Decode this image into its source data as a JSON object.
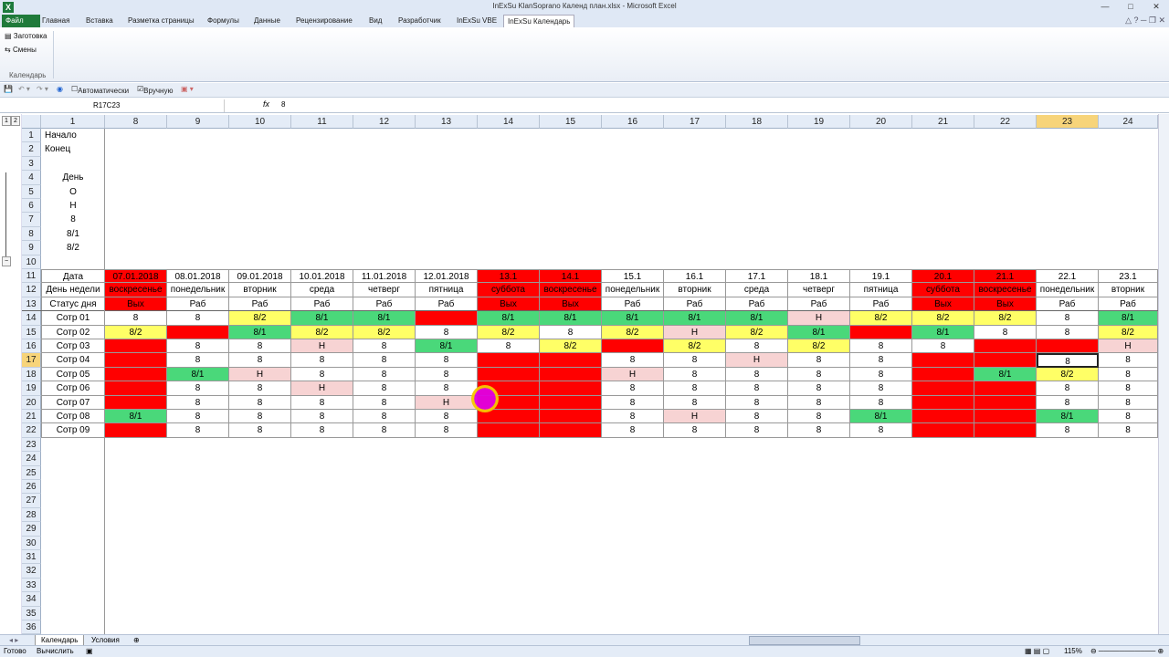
{
  "title": "InExSu KlanSoprano Календ план.xlsx - Microsoft Excel",
  "tabs": [
    "Файл",
    "Главная",
    "Вставка",
    "Разметка страницы",
    "Формулы",
    "Данные",
    "Рецензирование",
    "Вид",
    "Разработчик",
    "InExSu VBE",
    "InExSu Календарь"
  ],
  "ribbon": {
    "btn1": "Заготовка",
    "btn2": "Смены",
    "group": "Календарь"
  },
  "qat": {
    "auto": "Автоматически",
    "manual": "Вручную"
  },
  "formula": {
    "namebox": "R17C23",
    "fx": "fx",
    "value": "8"
  },
  "columns": [
    "1",
    "8",
    "9",
    "10",
    "11",
    "12",
    "13",
    "14",
    "15",
    "16",
    "17",
    "18",
    "19",
    "20",
    "21",
    "22",
    "23",
    "24"
  ],
  "rows": [
    "1",
    "2",
    "3",
    "4",
    "5",
    "6",
    "7",
    "8",
    "9",
    "10",
    "11",
    "12",
    "13",
    "14",
    "15",
    "16",
    "17",
    "18",
    "19",
    "20",
    "21",
    "22",
    "23",
    "24",
    "25",
    "26",
    "27",
    "28",
    "29",
    "30",
    "31",
    "32",
    "33",
    "34",
    "35",
    "36"
  ],
  "top_labels": {
    "r1": "Начало",
    "r2": "Конец",
    "r4": "День",
    "r5": "О",
    "r6": "Н",
    "r7": "8",
    "r8": "8/1",
    "r9": "8/2"
  },
  "header_rows": {
    "date": [
      "Дата",
      "07.01.2018",
      "08.01.2018",
      "09.01.2018",
      "10.01.2018",
      "11.01.2018",
      "12.01.2018",
      "13.1",
      "14.1",
      "15.1",
      "16.1",
      "17.1",
      "18.1",
      "19.1",
      "20.1",
      "21.1",
      "22.1",
      "23.1"
    ],
    "weekday": [
      "День недели",
      "воскресенье",
      "понедельник",
      "вторник",
      "среда",
      "четверг",
      "пятница",
      "суббота",
      "воскресенье",
      "понедельник",
      "вторник",
      "среда",
      "четверг",
      "пятница",
      "суббота",
      "воскресенье",
      "понедельник",
      "вторник"
    ],
    "status": [
      "Статус дня",
      "Вых",
      "Раб",
      "Раб",
      "Раб",
      "Раб",
      "Раб",
      "Вых",
      "Вых",
      "Раб",
      "Раб",
      "Раб",
      "Раб",
      "Раб",
      "Вых",
      "Вых",
      "Раб",
      "Раб"
    ]
  },
  "staff": [
    {
      "name": "Сотр 01",
      "cells": [
        "8",
        "8",
        "8/2",
        "8/1",
        "8/1",
        "",
        "8/1",
        "8/1",
        "8/1",
        "8/1",
        "8/1",
        "Н",
        "8/2",
        "8/2",
        "8/2",
        "8",
        "8/1"
      ],
      "colors": [
        "",
        "",
        "y",
        "g",
        "g",
        "r",
        "g",
        "g",
        "g",
        "g",
        "g",
        "p",
        "y",
        "y",
        "y",
        "",
        "g"
      ]
    },
    {
      "name": "Сотр 02",
      "cells": [
        "8/2",
        "",
        "8/1",
        "8/2",
        "8/2",
        "8",
        "8/2",
        "8",
        "8/2",
        "Н",
        "8/2",
        "8/1",
        "",
        "8/1",
        "8",
        "8",
        "8/2"
      ],
      "colors": [
        "y",
        "r",
        "g",
        "y",
        "y",
        "",
        "y",
        "",
        "y",
        "p",
        "y",
        "g",
        "r",
        "g",
        "",
        "",
        "y"
      ]
    },
    {
      "name": "Сотр 03",
      "cells": [
        "",
        "8",
        "8",
        "Н",
        "8",
        "8/1",
        "8",
        "8/2",
        "",
        "8/2",
        "8",
        "8/2",
        "8",
        "8",
        "",
        "",
        "Н"
      ],
      "colors": [
        "r",
        "",
        "",
        "p",
        "",
        "g",
        "",
        "y",
        "r",
        "y",
        "",
        "y",
        "",
        "",
        "r",
        "r",
        "p"
      ]
    },
    {
      "name": "Сотр 04",
      "cells": [
        "",
        "8",
        "8",
        "8",
        "8",
        "8",
        "",
        "",
        "8",
        "8",
        "Н",
        "8",
        "8",
        "",
        "",
        "8",
        "8"
      ],
      "colors": [
        "r",
        "",
        "",
        "",
        "",
        "",
        "r",
        "r",
        "",
        "",
        "p",
        "",
        "",
        "r",
        "r",
        "sel",
        ""
      ]
    },
    {
      "name": "Сотр 05",
      "cells": [
        "",
        "8/1",
        "Н",
        "8",
        "8",
        "8",
        "",
        "",
        "Н",
        "8",
        "8",
        "8",
        "8",
        "",
        "8/1",
        "8/2",
        "8"
      ],
      "colors": [
        "r",
        "g",
        "p",
        "",
        "",
        "",
        "r",
        "r",
        "p",
        "",
        "",
        "",
        "",
        "r",
        "g",
        "y",
        ""
      ]
    },
    {
      "name": "Сотр 06",
      "cells": [
        "",
        "8",
        "8",
        "Н",
        "8",
        "8",
        "",
        "",
        "8",
        "8",
        "8",
        "8",
        "8",
        "",
        "",
        "8",
        "8"
      ],
      "colors": [
        "r",
        "",
        "",
        "p",
        "",
        "",
        "r",
        "r",
        "",
        "",
        "",
        "",
        "",
        "r",
        "r",
        "",
        ""
      ]
    },
    {
      "name": "Сотр 07",
      "cells": [
        "",
        "8",
        "8",
        "8",
        "8",
        "Н",
        "",
        "",
        "8",
        "8",
        "8",
        "8",
        "8",
        "",
        "",
        "8",
        "8"
      ],
      "colors": [
        "r",
        "",
        "",
        "",
        "",
        "p",
        "r",
        "r",
        "",
        "",
        "",
        "",
        "",
        "r",
        "r",
        "",
        ""
      ]
    },
    {
      "name": "Сотр 08",
      "cells": [
        "8/1",
        "8",
        "8",
        "8",
        "8",
        "8",
        "",
        "",
        "8",
        "Н",
        "8",
        "8",
        "8/1",
        "",
        "",
        "8/1",
        "8"
      ],
      "colors": [
        "g",
        "",
        "",
        "",
        "",
        "",
        "r",
        "r",
        "",
        "p",
        "",
        "",
        "g",
        "r",
        "r",
        "g",
        ""
      ]
    },
    {
      "name": "Сотр 09",
      "cells": [
        "",
        "8",
        "8",
        "8",
        "8",
        "8",
        "",
        "",
        "8",
        "8",
        "8",
        "8",
        "8",
        "",
        "",
        "8",
        "8"
      ],
      "colors": [
        "r",
        "",
        "",
        "",
        "",
        "",
        "r",
        "r",
        "",
        "",
        "",
        "",
        "",
        "r",
        "r",
        "",
        ""
      ]
    }
  ],
  "sheets": [
    "Календарь",
    "Условия"
  ],
  "status": {
    "ready": "Готово",
    "calc": "Вычислить",
    "zoom": "115%"
  }
}
